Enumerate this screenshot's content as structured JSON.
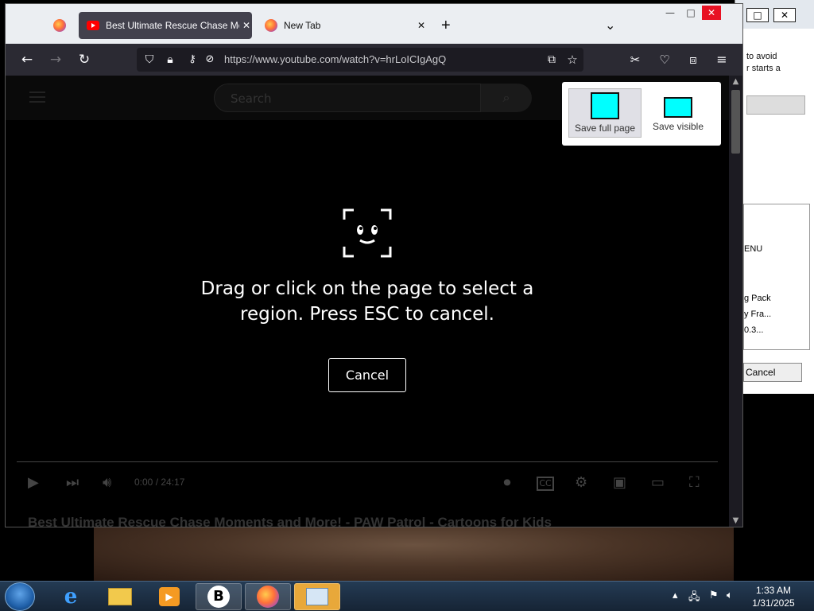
{
  "browser": {
    "tabs": [
      {
        "label": "",
        "icon": "firefox-icon",
        "active": false
      },
      {
        "label": "Best Ultimate Rescue Chase Mo",
        "icon": "youtube-icon",
        "active": true
      },
      {
        "label": "New Tab",
        "icon": "firefox-icon",
        "active": false
      }
    ],
    "new_tab_symbol": "+",
    "tab_list_symbol": "⌄",
    "url": "https://www.youtube.com/watch?v=hrLoICIgAgQ"
  },
  "youtube": {
    "search_placeholder": "Search",
    "time": "0:00 / 24:17",
    "video_title": "Best Ultimate Rescue Chase Moments and More! - PAW Patrol - Cartoons for Kids"
  },
  "screenshot_tool": {
    "instructions_line1": "Drag or click on the page to select a",
    "instructions_line2": "region. Press ESC to cancel.",
    "cancel_label": "Cancel",
    "options": [
      {
        "label": "Save full page"
      },
      {
        "label": "Save visible"
      }
    ]
  },
  "background_window": {
    "text_line1": "to avoid",
    "text_line2": "r starts a",
    "list_items": [
      "ENU",
      "g Pack",
      "y Fra...",
      "0.3..."
    ],
    "cancel_label": "Cancel"
  },
  "taskbar": {
    "time": "1:33 AM",
    "date": "1/31/2025",
    "items": [
      "internet-explorer-icon",
      "file-explorer-icon",
      "media-player-icon",
      "b-app-icon",
      "firefox-icon",
      "control-panel-icon"
    ]
  },
  "colors": {
    "accent_cyan": "#00ffff",
    "youtube_red": "#ff0000"
  }
}
